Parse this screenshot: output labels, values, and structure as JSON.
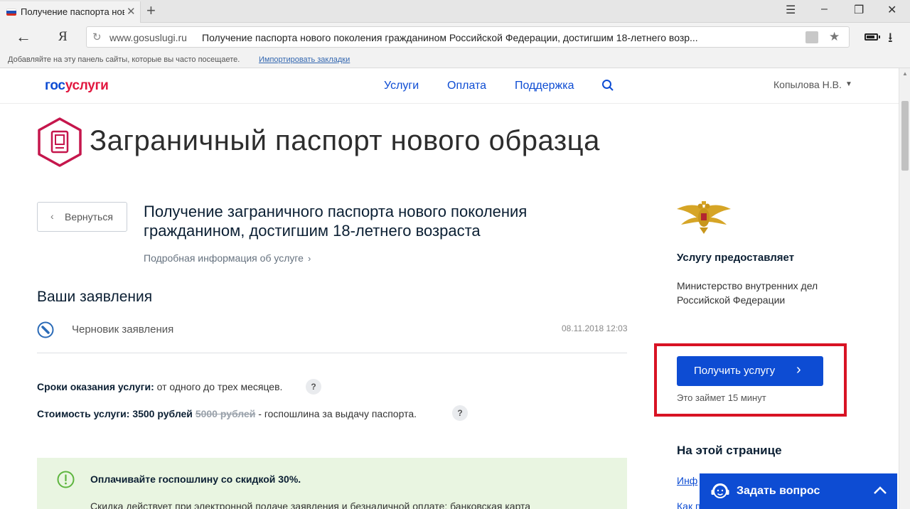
{
  "browser": {
    "tab_title": "Получение паспорта нового поколения",
    "tab_close": "✕",
    "new_tab": "+",
    "window_controls": [
      "☰",
      "–",
      "❐",
      "✕"
    ],
    "back": "←",
    "yandex_button": "Я",
    "url_domain": "www.gosuslugi.ru",
    "url_page_title": "Получение паспорта нового поколения гражданином Российской Федерации, достигшим 18-летнего возр...",
    "star": "★",
    "download": "⭳",
    "bookmarks_hint": "Добавляйте на эту панель сайты, которые вы часто посещаете.",
    "bookmarks_import": "Импортировать закладки"
  },
  "header": {
    "logo_part1": "гос",
    "logo_part2": "услуги",
    "nav": [
      "Услуги",
      "Оплата",
      "Поддержка"
    ],
    "user": "Копылова Н.В."
  },
  "main": {
    "page_title": "Заграничный паспорт нового образца",
    "back_label": "Вернуться",
    "service_title": "Получение заграничного паспорта нового поколения гражданином, достигшим 18-летнего возраста",
    "more_info": "Подробная информация об услуге",
    "applications_heading": "Ваши заявления",
    "draft_label": "Черновик заявления",
    "draft_date": "08.11.2018 12:03",
    "term_label": "Сроки оказания услуги:",
    "term_value": "от одного до трех месяцев.",
    "cost_label": "Стоимость услуги:",
    "cost_new": "3500 рублей",
    "cost_old": "5000 рублей",
    "cost_note": "- госпошлина за выдачу паспорта.",
    "help_mark": "?",
    "discount_title": "Оплачивайте госпошлину со скидкой 30%.",
    "discount_text": "Скидка действует при электронной подаче заявления и безналичной оплате: банковская карта"
  },
  "sidebar": {
    "provider_heading": "Услугу предоставляет",
    "provider_name": "Министерство внутренних дел Российской Федерации",
    "get_service": "Получить услугу",
    "takes_time": "Это займет 15 минут",
    "on_page_heading": "На этой странице",
    "on_page_links": [
      "Инф",
      "Как п"
    ]
  },
  "ask_widget": {
    "label": "Задать вопрос"
  },
  "colors": {
    "brand_blue": "#0d4cd3",
    "brand_red": "#e1173f",
    "highlight_red": "#d81324",
    "discount_bg": "#e9f5e1"
  }
}
